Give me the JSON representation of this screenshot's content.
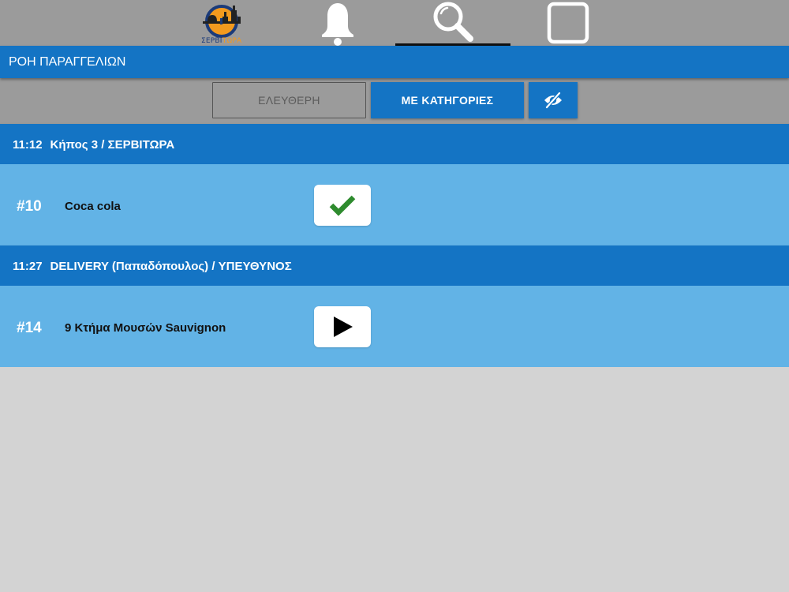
{
  "colors": {
    "nav_bg": "#9b9b9b",
    "primary_blue": "#1474c4",
    "item_blue": "#62b3e6",
    "check_green": "#2e8b2e",
    "page_bg": "#d3d3d3"
  },
  "topnav": {
    "logo": {
      "text_main": "ΣΕΡΒΙ",
      "text_accent": "ΤΩΡΑ"
    },
    "items": [
      {
        "icon": "bell-icon",
        "active": false
      },
      {
        "icon": "search-icon",
        "active": true
      },
      {
        "icon": "square-icon",
        "active": false
      }
    ]
  },
  "titlebar": {
    "title": "ΡΟΗ ΠΑΡΑΓΓΕΛΙΩΝ"
  },
  "filters": {
    "free_label": "ΕΛΕΥΘΕΡΗ",
    "category_label": "ΜΕ ΚΑΤΗΓΟΡΙΕΣ",
    "hide_icon": "eye-slash-icon"
  },
  "orders": [
    {
      "time": "11:12",
      "title": "Κήπος 3 / ΣΕΡΒΙΤΩΡΑ",
      "items": [
        {
          "number": "#10",
          "name": "Coca cola",
          "status": "done",
          "action_icon": "check-icon"
        }
      ]
    },
    {
      "time": "11:27",
      "title": "DELIVERY (Παπαδόπουλος) / ΥΠΕΥΘΥΝΟΣ",
      "items": [
        {
          "number": "#14",
          "name": "9 Κτήμα Μουσών Sauvignon",
          "status": "pending",
          "action_icon": "play-icon"
        }
      ]
    }
  ]
}
